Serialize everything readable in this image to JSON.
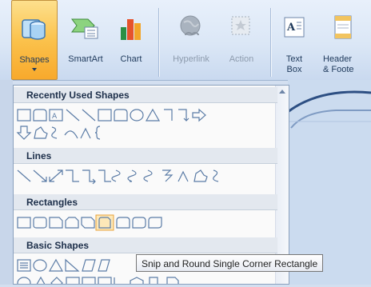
{
  "ribbon": {
    "shapes_label": "Shapes",
    "smartart_label": "SmartArt",
    "chart_label": "Chart",
    "hyperlink_label": "Hyperlink",
    "action_label": "Action",
    "textbox_label_1": "Text",
    "textbox_label_2": "Box",
    "header_label_1": "Header",
    "header_label_2": "& Foote"
  },
  "gallery": {
    "recent_label": "Recently Used Shapes",
    "lines_label": "Lines",
    "rectangles_label": "Rectangles",
    "basic_label": "Basic Shapes"
  },
  "tooltip": {
    "text": "Snip and Round Single Corner Rectangle"
  },
  "colors": {
    "accent": "#fbc24c",
    "shape_stroke": "#5b7ca6",
    "selected": "#e8a23a"
  }
}
